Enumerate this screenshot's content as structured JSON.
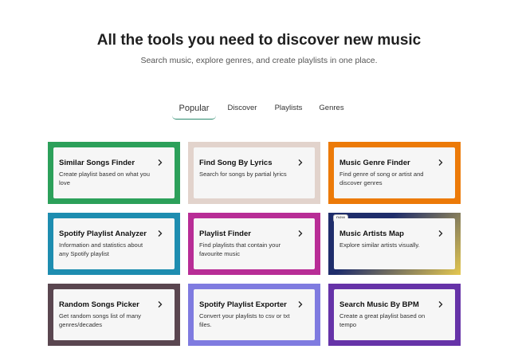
{
  "hero": {
    "title": "All the tools you need to discover new music",
    "subtitle": "Search music, explore genres, and create playlists in one place."
  },
  "tabs": [
    {
      "label": "Popular",
      "active": true
    },
    {
      "label": "Discover",
      "active": false
    },
    {
      "label": "Playlists",
      "active": false
    },
    {
      "label": "Genres",
      "active": false
    }
  ],
  "cards": [
    {
      "title": "Similar Songs Finder",
      "desc": "Create playlist based on what you love",
      "color": "#2ca05a"
    },
    {
      "title": "Find Song By Lyrics",
      "desc": "Search for songs by partial lyrics",
      "color": "#e2d3cc"
    },
    {
      "title": "Music Genre Finder",
      "desc": "Find genre of song or artist and discover genres",
      "color": "#ec7a08"
    },
    {
      "title": "Spotify Playlist Analyzer",
      "desc": "Information and statistics about any Spotify playlist",
      "color": "#1e8db0"
    },
    {
      "title": "Playlist Finder",
      "desc": "Find playlists that contain your favourite music",
      "color": "#b82d96"
    },
    {
      "title": "Music Artists Map",
      "desc": "Explore similar artists visually.",
      "badge": "new",
      "gradient": [
        "#1f2d6b",
        "#e5c84f"
      ]
    },
    {
      "title": "Random Songs Picker",
      "desc": "Get random songs list of many genres/decades",
      "color": "#5a4650"
    },
    {
      "title": "Spotify Playlist Exporter",
      "desc": "Convert your playlists to csv or txt files.",
      "color": "#7f7be0"
    },
    {
      "title": "Search Music By BPM",
      "desc": "Create a great playlist based on tempo",
      "color": "#6633a8"
    }
  ]
}
